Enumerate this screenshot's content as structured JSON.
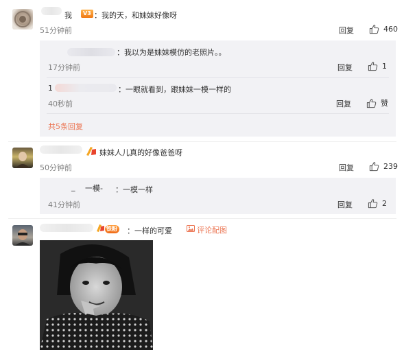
{
  "comments": [
    {
      "username": "我",
      "text": "：我的天，和妹妹好像呀",
      "time": "51分钟前",
      "reply_label": "回复",
      "likes": "460",
      "replies": [
        {
          "text": "：我以为是妹妹模仿的老照片。。",
          "time": "17分钟前",
          "reply_label": "回复",
          "likes": "1"
        },
        {
          "prefix": "1",
          "text": "：一眼就看到，跟妹妹一模一样的",
          "time": "40秒前",
          "reply_label": "回复",
          "likes": "赞"
        }
      ],
      "more_replies": "共5条回复"
    },
    {
      "text": "妹妹人儿真的好像爸爸呀",
      "time": "50分钟前",
      "reply_label": "回复",
      "likes": "239",
      "replies": [
        {
          "prefix": "_",
          "username": "一模-",
          "text": "：一模一样",
          "time": "41分钟前",
          "reply_label": "回复",
          "likes": "2"
        }
      ]
    },
    {
      "badge_fan": "铁粉",
      "text": "：一样的可爱",
      "image_link": "评论配图"
    }
  ],
  "badge_vip": "V3",
  "colors": {
    "link": "#eb7350",
    "panel": "#f2f2f5",
    "time": "#808080"
  }
}
